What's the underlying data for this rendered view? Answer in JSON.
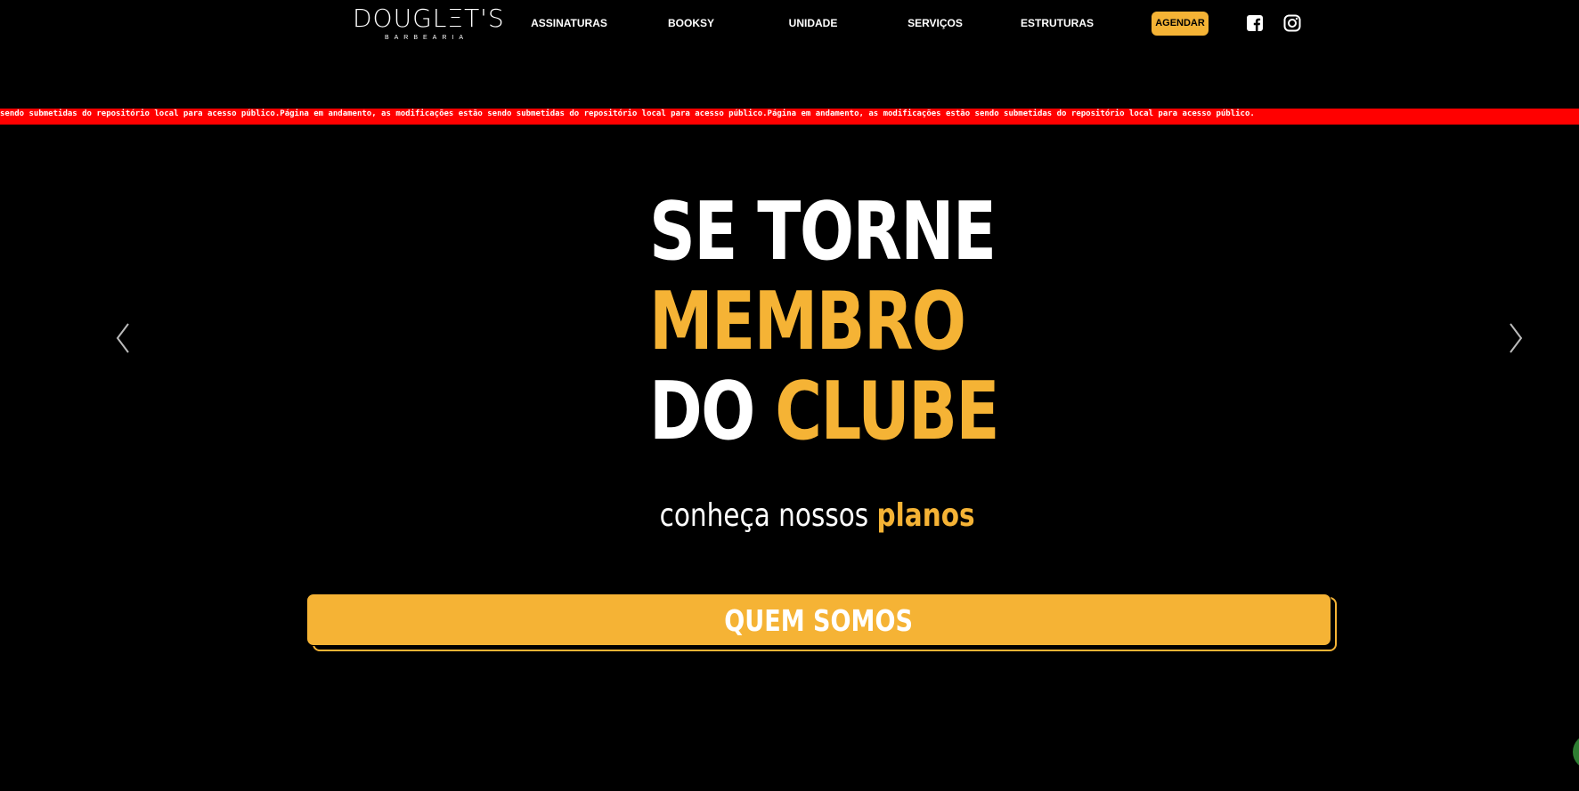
{
  "header": {
    "logo": {
      "name": "DOUGLΞT'S",
      "tagline": "BARBEARIA"
    },
    "nav": [
      {
        "label": "ASSINATURAS"
      },
      {
        "label": "BOOKSY"
      },
      {
        "label": "UNIDADE"
      },
      {
        "label": "SERVIÇOS"
      },
      {
        "label": "ESTRUTURAS"
      }
    ],
    "cta_label": "AGENDAR",
    "social": [
      "facebook-icon",
      "instagram-icon"
    ]
  },
  "ticker": {
    "text": "sendo submetidas do repositório local para acesso público.Página em andamento, as modificações estão sendo submetidas do repositório local para acesso público.Página em andamento, as modificações estão sendo submetidas do repositório local para acesso público."
  },
  "hero": {
    "line1": "SE TORNE",
    "line2": "MEMBRO",
    "line3_white": "DO",
    "line3_gold": "CLUBE",
    "sub_plain": "conheça nossos",
    "sub_accent": "planos",
    "button_label": "QUEM SOMOS",
    "prev_icon": "chevron-left-icon",
    "next_icon": "chevron-right-icon"
  },
  "colors": {
    "background": "#000000",
    "accent": "#f5b335",
    "ticker": "#ff0000",
    "text": "#ffffff"
  }
}
